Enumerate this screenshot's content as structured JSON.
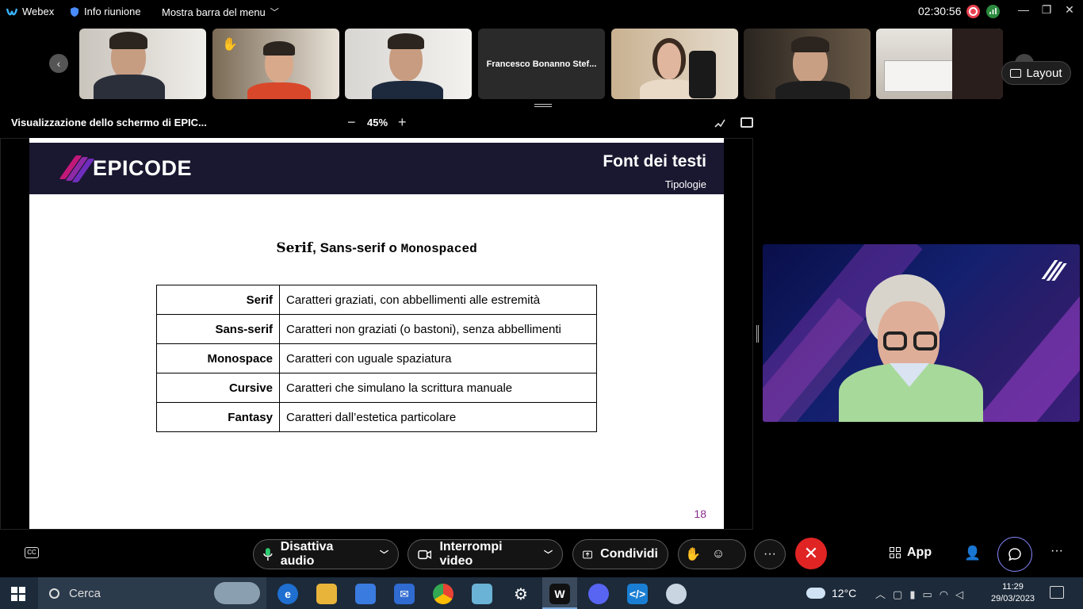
{
  "topbar": {
    "app_name": "Webex",
    "meeting_info": "Info riunione",
    "menu_toggle": "Mostra barra del menu",
    "timer": "02:30:56",
    "recording_icon": "recording-icon",
    "stats_icon": "network-stats-icon",
    "win_controls": [
      "—",
      "❐",
      "✕"
    ]
  },
  "strip": {
    "participants": [
      {
        "type": "video"
      },
      {
        "type": "video",
        "raised_hand": true
      },
      {
        "type": "video"
      },
      {
        "type": "name",
        "name": "Francesco Bonanno Stef..."
      },
      {
        "type": "video"
      },
      {
        "type": "video"
      },
      {
        "type": "video"
      }
    ],
    "layout_label": "Layout"
  },
  "share": {
    "title": "Visualizzazione dello schermo di EPIC...",
    "zoom_minus": "−",
    "zoom_level": "45%",
    "zoom_plus": "+"
  },
  "slide": {
    "brand": "EPICODE",
    "title": "Font dei testi",
    "subtitle": "Tipologie",
    "heading_serif": "Serif",
    "heading_sep": ", ",
    "heading_sans": "Sans-serif",
    "heading_o": " o ",
    "heading_mono": "Monospaced",
    "rows": [
      {
        "k": "Serif",
        "v": "Caratteri graziati, con abbellimenti alle estremità"
      },
      {
        "k": "Sans-serif",
        "v": "Caratteri non graziati (o bastoni), senza abbellimenti"
      },
      {
        "k": "Monospace",
        "v": "Caratteri con uguale spaziatura"
      },
      {
        "k": "Cursive",
        "v": "Caratteri che simulano la scrittura manuale"
      },
      {
        "k": "Fantasy",
        "v": "Caratteri dall’estetica particolare"
      }
    ],
    "page": "18"
  },
  "controls": {
    "mute_label": "Disattiva audio",
    "video_label": "Interrompi video",
    "share_label": "Condividi",
    "apps_label": "App",
    "end_icon": "✕",
    "more": "···"
  },
  "taskbar": {
    "search_placeholder": "Cerca",
    "temperature": "12°C",
    "time": "11:29",
    "date": "29/03/2023"
  },
  "colors": {
    "accent": "#e8414f",
    "end_call": "#e02424",
    "brand_dark": "#1a1730",
    "brand_magenta": "#c2187a",
    "brand_violet": "#6f2dbd"
  }
}
